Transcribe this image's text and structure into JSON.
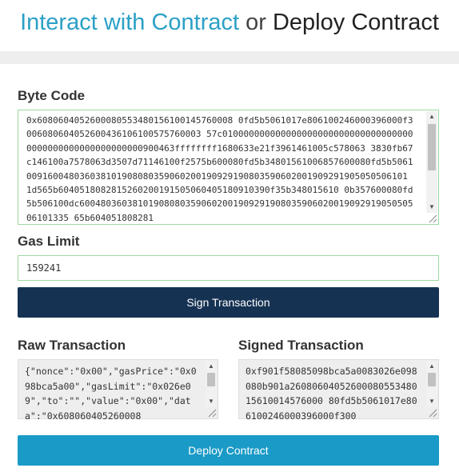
{
  "header": {
    "interact_link": "Interact with Contract",
    "or_text": "or",
    "deploy_title": "Deploy Contract"
  },
  "bytecode": {
    "label": "Byte Code",
    "value": "0x6080604052600080553480156100145760008 0fd5b5061017e806100246000396000f3006080604052600436106100575760003 57c0100000000000000000000000000000000000000000000000000000000900463ffffffff1680633e21f3961461005c578063 3830fb67c146100a7578063d3507d71146100f2575b600080fd5b34801561006857600080fd5b5061009160048036038101908080359060200190929190803590602001909291905050506101 1d565b6040518082815260200191505060405180910390f35b348015610 0b357600080fd5b506100dc60048036038101908080359060200190929190803590602001909291905050506101335 65b604051808281"
  },
  "gas": {
    "label": "Gas Limit",
    "value": "159241"
  },
  "sign_button": {
    "label": "Sign Transaction"
  },
  "raw_tx": {
    "label": "Raw Transaction",
    "value": "{\"nonce\":\"0x00\",\"gasPrice\":\"0x098bca5a00\",\"gasLimit\":\"0x026e09\",\"to\":\"\",\"value\":\"0x00\",\"data\":\"0x608060405260008"
  },
  "signed_tx": {
    "label": "Signed Transaction",
    "value": "0xf901f58085098bca5a0083026e098080b901a2608060405260008055348015610014576000 80fd5b5061017e806100246000396000f300"
  },
  "deploy_button": {
    "label": "Deploy Contract"
  },
  "colors": {
    "accent": "#2ba0c6",
    "navy": "#163253",
    "valid_border": "#9fd8a3"
  }
}
